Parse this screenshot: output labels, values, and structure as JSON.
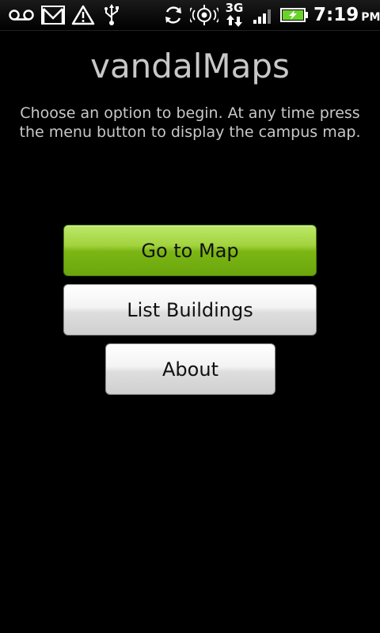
{
  "status_bar": {
    "icons": [
      "voicemail-icon",
      "gmail-icon",
      "alert-icon",
      "usb-icon",
      "sync-icon",
      "gps-icon",
      "signal-icon",
      "battery-charging-icon"
    ],
    "network": "3G",
    "time": "7:19",
    "ampm": "PM",
    "accent_color": "#6bd12b"
  },
  "main": {
    "title": "vandalMaps",
    "instructions": "Choose an option to begin. At any time press the menu button to display the campus map.",
    "buttons": {
      "map": "Go to Map",
      "list": "List Buildings",
      "about": "About"
    }
  },
  "colors": {
    "primary_button": "#8cc63f",
    "secondary_button": "#e6e6e6",
    "background": "#000000",
    "text": "#c8c8c8"
  }
}
